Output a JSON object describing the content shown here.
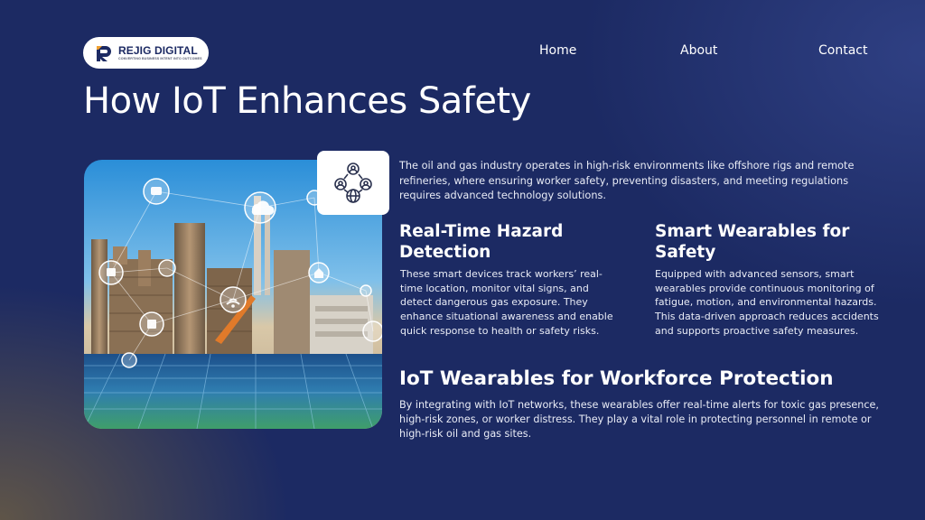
{
  "brand": {
    "name": "REJIG DIGITAL",
    "tagline": "CONVERTING BUSINESS INTENT INTO OUTCOMES",
    "icon": "rejig-logo-mark"
  },
  "nav": {
    "home": "Home",
    "about": "About",
    "contact": "Contact"
  },
  "page": {
    "title": "How IoT Enhances Safety"
  },
  "hero": {
    "icon": "industrial-iot-photo"
  },
  "icon_card": {
    "icon": "connected-people-network-icon"
  },
  "intro": "The oil and gas industry operates in high-risk environments like offshore rigs and remote refineries, where ensuring worker safety, preventing disasters, and meeting regulations requires advanced technology solutions.",
  "sections": {
    "hazard": {
      "title": "Real-Time Hazard Detection",
      "body": "These smart devices track workers’ real-time location, monitor vital signs, and detect dangerous gas exposure. They enhance situational awareness and enable quick response to health or safety risks."
    },
    "wearables": {
      "title": "Smart Wearables for Safety",
      "body": "Equipped with advanced sensors, smart wearables provide continuous monitoring of fatigue, motion, and environmental hazards. This data-driven approach reduces accidents and supports proactive safety measures."
    },
    "workforce": {
      "title": "IoT Wearables for Workforce Protection",
      "body": "By integrating with IoT networks, these wearables offer real-time alerts for toxic gas presence, high-risk zones, or worker distress. They play a vital role in protecting personnel in remote or high-risk oil and gas sites."
    }
  },
  "colors": {
    "background": "#1c2a63",
    "accent": "#f0a030",
    "text": "#ffffff"
  }
}
